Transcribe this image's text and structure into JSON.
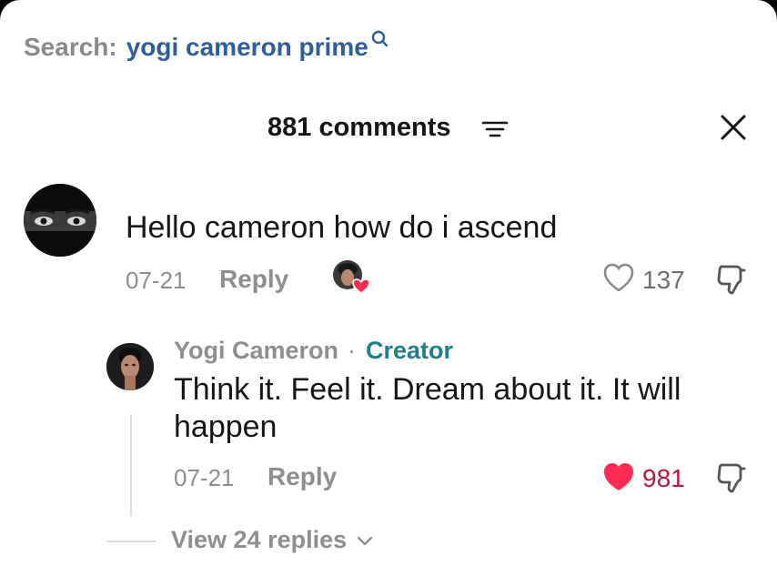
{
  "search": {
    "label": "Search:",
    "term": "yogi cameron prime"
  },
  "header": {
    "comments_title": "881 comments"
  },
  "comments": [
    {
      "text": "Hello cameron how do i ascend",
      "date": "07-21",
      "reply_label": "Reply",
      "like_count": "137",
      "liked_by_creator": true
    }
  ],
  "reply": {
    "author": "Yogi Cameron",
    "separator": "·",
    "badge": "Creator",
    "text": "Think it. Feel it. Dream about it. It will happen",
    "date": "07-21",
    "reply_label": "Reply",
    "like_count": "981",
    "liked": true
  },
  "thread": {
    "view_replies": "View 24 replies"
  },
  "colors": {
    "link_blue": "#2f5f96",
    "creator_teal": "#1f7f86",
    "like_red": "#fe2c55"
  },
  "icons": [
    "search-icon",
    "filter-icon",
    "close-icon",
    "heart-outline-icon",
    "heart-filled-icon",
    "dislike-icon",
    "chevron-down-icon"
  ]
}
